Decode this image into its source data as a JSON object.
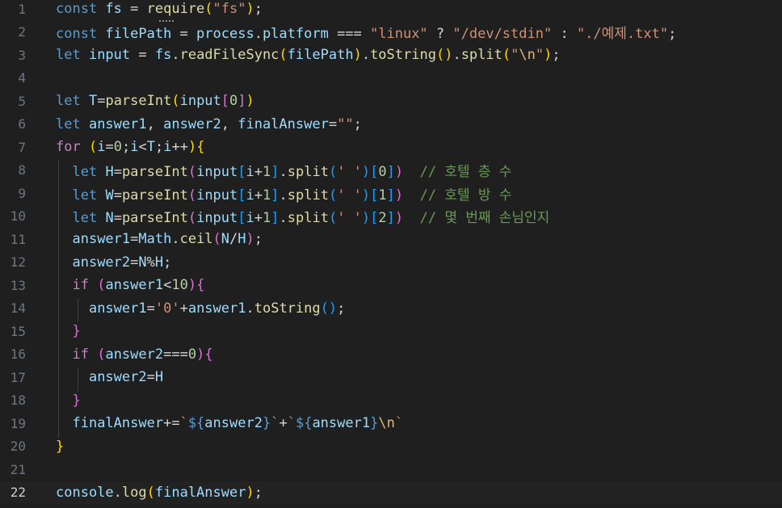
{
  "editor": {
    "active_line": 22,
    "lines": [
      {
        "n": "1",
        "tokens": [
          [
            "kw",
            "const "
          ],
          [
            "var",
            "fs"
          ],
          [
            "op",
            " = "
          ],
          [
            "fn",
            "require"
          ],
          [
            "b1",
            "("
          ],
          [
            "str",
            "\"fs\""
          ],
          [
            "b1",
            ")"
          ],
          [
            "op",
            ";"
          ]
        ]
      },
      {
        "n": "2",
        "tokens": [
          [
            "kw",
            "const "
          ],
          [
            "var",
            "filePath"
          ],
          [
            "op",
            " = "
          ],
          [
            "var",
            "process"
          ],
          [
            "op",
            "."
          ],
          [
            "var",
            "platform"
          ],
          [
            "op",
            " === "
          ],
          [
            "str",
            "\"linux\""
          ],
          [
            "op",
            " ? "
          ],
          [
            "str",
            "\"/dev/stdin\""
          ],
          [
            "op",
            " : "
          ],
          [
            "str",
            "\"./예제.txt\""
          ],
          [
            "op",
            ";"
          ]
        ]
      },
      {
        "n": "3",
        "tokens": [
          [
            "kw",
            "let "
          ],
          [
            "var",
            "input"
          ],
          [
            "op",
            " = "
          ],
          [
            "var",
            "fs"
          ],
          [
            "op",
            "."
          ],
          [
            "fn",
            "readFileSync"
          ],
          [
            "b1",
            "("
          ],
          [
            "var",
            "filePath"
          ],
          [
            "b1",
            ")"
          ],
          [
            "op",
            "."
          ],
          [
            "fn",
            "toString"
          ],
          [
            "b1",
            "()"
          ],
          [
            "op",
            "."
          ],
          [
            "fn",
            "split"
          ],
          [
            "b1",
            "("
          ],
          [
            "str",
            "\""
          ],
          [
            "esc",
            "\\n"
          ],
          [
            "str",
            "\""
          ],
          [
            "b1",
            ")"
          ],
          [
            "op",
            ";"
          ]
        ]
      },
      {
        "n": "4",
        "tokens": []
      },
      {
        "n": "5",
        "tokens": [
          [
            "kw",
            "let "
          ],
          [
            "var",
            "T"
          ],
          [
            "op",
            "="
          ],
          [
            "fn",
            "parseInt"
          ],
          [
            "b1",
            "("
          ],
          [
            "var",
            "input"
          ],
          [
            "b2",
            "["
          ],
          [
            "num",
            "0"
          ],
          [
            "b2",
            "]"
          ],
          [
            "b1",
            ")"
          ]
        ]
      },
      {
        "n": "6",
        "tokens": [
          [
            "kw",
            "let "
          ],
          [
            "var",
            "answer1"
          ],
          [
            "op",
            ", "
          ],
          [
            "var",
            "answer2"
          ],
          [
            "op",
            ", "
          ],
          [
            "var",
            "finalAnswer"
          ],
          [
            "op",
            "="
          ],
          [
            "str",
            "\"\""
          ],
          [
            "op",
            ";"
          ]
        ]
      },
      {
        "n": "7",
        "tokens": [
          [
            "ctl",
            "for "
          ],
          [
            "b1",
            "("
          ],
          [
            "var",
            "i"
          ],
          [
            "op",
            "="
          ],
          [
            "num",
            "0"
          ],
          [
            "op",
            ";"
          ],
          [
            "var",
            "i"
          ],
          [
            "op",
            "<"
          ],
          [
            "var",
            "T"
          ],
          [
            "op",
            ";"
          ],
          [
            "var",
            "i"
          ],
          [
            "op",
            "++"
          ],
          [
            "b1",
            ")"
          ],
          [
            "b1",
            "{"
          ]
        ]
      },
      {
        "n": "8",
        "tokens": [
          [
            "op",
            "  "
          ],
          [
            "kw",
            "let "
          ],
          [
            "var",
            "H"
          ],
          [
            "op",
            "="
          ],
          [
            "fn",
            "parseInt"
          ],
          [
            "b2",
            "("
          ],
          [
            "var",
            "input"
          ],
          [
            "b3",
            "["
          ],
          [
            "var",
            "i"
          ],
          [
            "op",
            "+"
          ],
          [
            "num",
            "1"
          ],
          [
            "b3",
            "]"
          ],
          [
            "op",
            "."
          ],
          [
            "fn",
            "split"
          ],
          [
            "b3",
            "("
          ],
          [
            "str",
            "' '"
          ],
          [
            "b3",
            ")"
          ],
          [
            "b3",
            "["
          ],
          [
            "num",
            "0"
          ],
          [
            "b3",
            "]"
          ],
          [
            "b2",
            ")"
          ],
          [
            "op",
            "  "
          ],
          [
            "cmt",
            "// 호텔 층 수"
          ]
        ]
      },
      {
        "n": "9",
        "tokens": [
          [
            "op",
            "  "
          ],
          [
            "kw",
            "let "
          ],
          [
            "var",
            "W"
          ],
          [
            "op",
            "="
          ],
          [
            "fn",
            "parseInt"
          ],
          [
            "b2",
            "("
          ],
          [
            "var",
            "input"
          ],
          [
            "b3",
            "["
          ],
          [
            "var",
            "i"
          ],
          [
            "op",
            "+"
          ],
          [
            "num",
            "1"
          ],
          [
            "b3",
            "]"
          ],
          [
            "op",
            "."
          ],
          [
            "fn",
            "split"
          ],
          [
            "b3",
            "("
          ],
          [
            "str",
            "' '"
          ],
          [
            "b3",
            ")"
          ],
          [
            "b3",
            "["
          ],
          [
            "num",
            "1"
          ],
          [
            "b3",
            "]"
          ],
          [
            "b2",
            ")"
          ],
          [
            "op",
            "  "
          ],
          [
            "cmt",
            "// 호텔 방 수"
          ]
        ]
      },
      {
        "n": "10",
        "tokens": [
          [
            "op",
            "  "
          ],
          [
            "kw",
            "let "
          ],
          [
            "var",
            "N"
          ],
          [
            "op",
            "="
          ],
          [
            "fn",
            "parseInt"
          ],
          [
            "b2",
            "("
          ],
          [
            "var",
            "input"
          ],
          [
            "b3",
            "["
          ],
          [
            "var",
            "i"
          ],
          [
            "op",
            "+"
          ],
          [
            "num",
            "1"
          ],
          [
            "b3",
            "]"
          ],
          [
            "op",
            "."
          ],
          [
            "fn",
            "split"
          ],
          [
            "b3",
            "("
          ],
          [
            "str",
            "' '"
          ],
          [
            "b3",
            ")"
          ],
          [
            "b3",
            "["
          ],
          [
            "num",
            "2"
          ],
          [
            "b3",
            "]"
          ],
          [
            "b2",
            ")"
          ],
          [
            "op",
            "  "
          ],
          [
            "cmt",
            "// 몇 번째 손님인지"
          ]
        ]
      },
      {
        "n": "11",
        "tokens": [
          [
            "op",
            "  "
          ],
          [
            "var",
            "answer1"
          ],
          [
            "op",
            "="
          ],
          [
            "var",
            "Math"
          ],
          [
            "op",
            "."
          ],
          [
            "fn",
            "ceil"
          ],
          [
            "b2",
            "("
          ],
          [
            "var",
            "N"
          ],
          [
            "op",
            "/"
          ],
          [
            "var",
            "H"
          ],
          [
            "b2",
            ")"
          ],
          [
            "op",
            ";"
          ]
        ]
      },
      {
        "n": "12",
        "tokens": [
          [
            "op",
            "  "
          ],
          [
            "var",
            "answer2"
          ],
          [
            "op",
            "="
          ],
          [
            "var",
            "N"
          ],
          [
            "op",
            "%"
          ],
          [
            "var",
            "H"
          ],
          [
            "op",
            ";"
          ]
        ]
      },
      {
        "n": "13",
        "tokens": [
          [
            "op",
            "  "
          ],
          [
            "ctl",
            "if "
          ],
          [
            "b2",
            "("
          ],
          [
            "var",
            "answer1"
          ],
          [
            "op",
            "<"
          ],
          [
            "num",
            "10"
          ],
          [
            "b2",
            ")"
          ],
          [
            "b2",
            "{"
          ]
        ]
      },
      {
        "n": "14",
        "tokens": [
          [
            "op",
            "    "
          ],
          [
            "var",
            "answer1"
          ],
          [
            "op",
            "="
          ],
          [
            "str",
            "'0'"
          ],
          [
            "op",
            "+"
          ],
          [
            "var",
            "answer1"
          ],
          [
            "op",
            "."
          ],
          [
            "fn",
            "toString"
          ],
          [
            "b3",
            "()"
          ],
          [
            "op",
            ";"
          ]
        ]
      },
      {
        "n": "15",
        "tokens": [
          [
            "op",
            "  "
          ],
          [
            "b2",
            "}"
          ]
        ]
      },
      {
        "n": "16",
        "tokens": [
          [
            "op",
            "  "
          ],
          [
            "ctl",
            "if "
          ],
          [
            "b2",
            "("
          ],
          [
            "var",
            "answer2"
          ],
          [
            "op",
            "==="
          ],
          [
            "num",
            "0"
          ],
          [
            "b2",
            ")"
          ],
          [
            "b2",
            "{"
          ]
        ]
      },
      {
        "n": "17",
        "tokens": [
          [
            "op",
            "    "
          ],
          [
            "var",
            "answer2"
          ],
          [
            "op",
            "="
          ],
          [
            "var",
            "H"
          ]
        ]
      },
      {
        "n": "18",
        "tokens": [
          [
            "op",
            "  "
          ],
          [
            "b2",
            "}"
          ]
        ]
      },
      {
        "n": "19",
        "tokens": [
          [
            "op",
            "  "
          ],
          [
            "var",
            "finalAnswer"
          ],
          [
            "op",
            "+="
          ],
          [
            "str",
            "`"
          ],
          [
            "tpl",
            "${"
          ],
          [
            "var",
            "answer2"
          ],
          [
            "tpl",
            "}"
          ],
          [
            "str",
            "`"
          ],
          [
            "op",
            "+"
          ],
          [
            "str",
            "`"
          ],
          [
            "tpl",
            "${"
          ],
          [
            "var",
            "answer1"
          ],
          [
            "tpl",
            "}"
          ],
          [
            "esc",
            "\\n"
          ],
          [
            "str",
            "`"
          ]
        ]
      },
      {
        "n": "20",
        "tokens": [
          [
            "b1",
            "}"
          ]
        ]
      },
      {
        "n": "21",
        "tokens": []
      },
      {
        "n": "22",
        "tokens": [
          [
            "var",
            "console"
          ],
          [
            "op",
            "."
          ],
          [
            "fn",
            "log"
          ],
          [
            "b1",
            "("
          ],
          [
            "var",
            "finalAnswer"
          ],
          [
            "b1",
            ")"
          ],
          [
            "op",
            ";"
          ]
        ]
      }
    ]
  }
}
